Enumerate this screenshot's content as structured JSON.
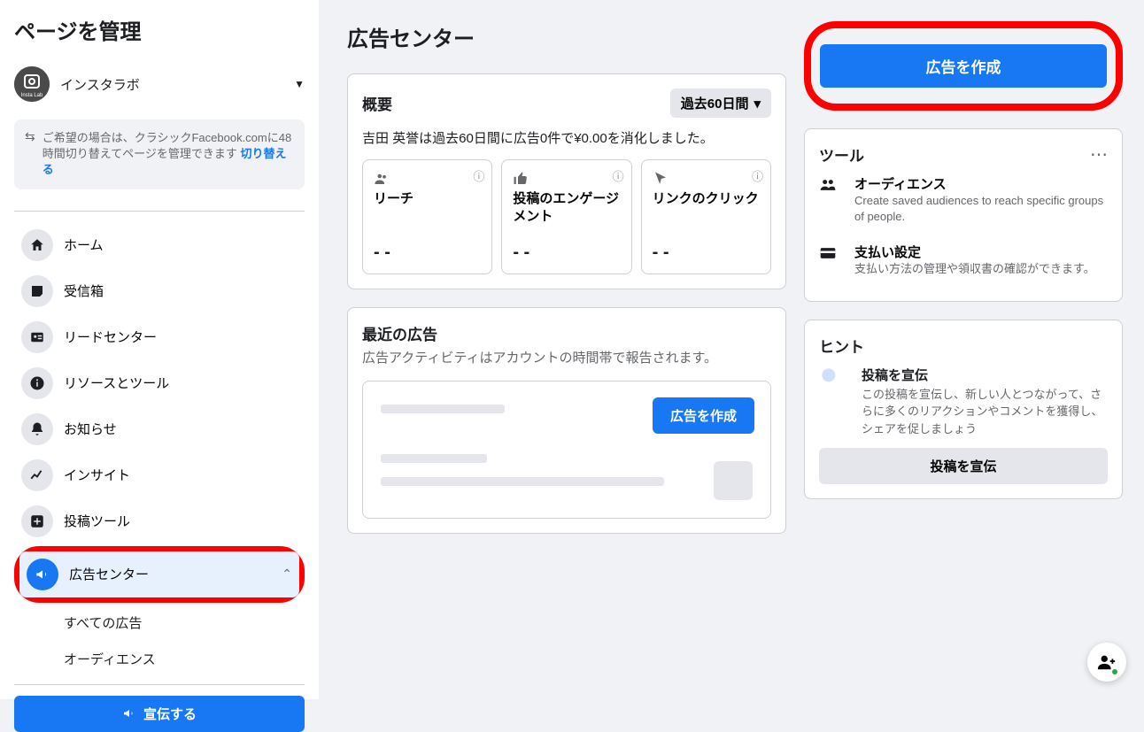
{
  "sidebar": {
    "title": "ページを管理",
    "page_name": "インスタラボ",
    "avatar_text": "Insta Lab",
    "notice": {
      "text": "ご希望の場合は、クラシックFacebook.comに48時間切り替えてページを管理できます",
      "link": "切り替える"
    },
    "nav": [
      {
        "label": "ホーム"
      },
      {
        "label": "受信箱"
      },
      {
        "label": "リードセンター"
      },
      {
        "label": "リソースとツール"
      },
      {
        "label": "お知らせ"
      },
      {
        "label": "インサイト"
      },
      {
        "label": "投稿ツール"
      },
      {
        "label": "広告センター"
      }
    ],
    "sub": [
      {
        "label": "すべての広告"
      },
      {
        "label": "オーディエンス"
      }
    ],
    "promote": "宣伝する"
  },
  "main": {
    "title": "広告センター",
    "overview": {
      "title": "概要",
      "range": "過去60日間",
      "summary": "吉田 英誉は過去60日間に広告0件で¥0.00を消化しました。",
      "stats": [
        {
          "label": "リーチ",
          "value": "- -"
        },
        {
          "label": "投稿のエンゲージメント",
          "value": "- -"
        },
        {
          "label": "リンクのクリック",
          "value": "- -"
        }
      ]
    },
    "recent": {
      "title": "最近の広告",
      "desc": "広告アクティビティはアカウントの時間帯で報告されます。",
      "button": "広告を作成"
    }
  },
  "right": {
    "create_ad": "広告を作成",
    "tools": {
      "title": "ツール",
      "items": [
        {
          "title": "オーディエンス",
          "desc": "Create saved audiences to reach specific groups of people."
        },
        {
          "title": "支払い設定",
          "desc": "支払い方法の管理や領収書の確認ができます。"
        }
      ]
    },
    "hints": {
      "title": "ヒント",
      "item": {
        "title": "投稿を宣伝",
        "desc": "この投稿を宣伝し、新しい人とつながって、さらに多くのリアクションやコメントを獲得し、シェアを促しましょう"
      },
      "button": "投稿を宣伝"
    }
  }
}
